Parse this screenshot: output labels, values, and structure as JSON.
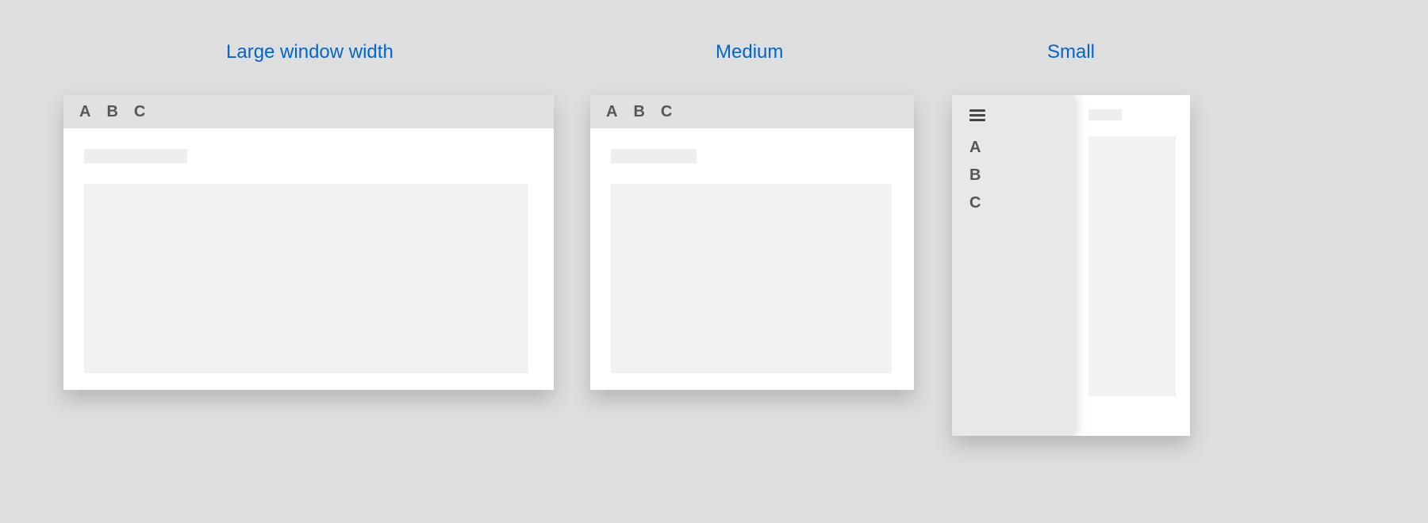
{
  "titles": {
    "large": "Large window width",
    "medium": "Medium",
    "small": "Small"
  },
  "tabs": {
    "a": "A",
    "b": "B",
    "c": "C"
  },
  "colors": {
    "title": "#0066cc",
    "background": "#dedede",
    "topbar": "#e1e1e1",
    "placeholder": "#eeeeee",
    "contentBlock": "#f1f1f1"
  }
}
